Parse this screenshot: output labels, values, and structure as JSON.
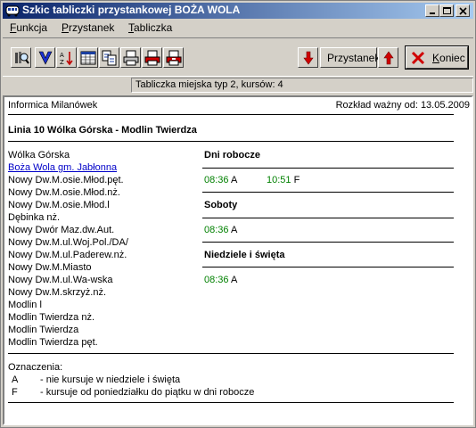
{
  "window": {
    "title": "Szkic tabliczki przystankowej BOŻA WOLA"
  },
  "menu": {
    "items": [
      {
        "first": "F",
        "rest": "unkcja"
      },
      {
        "first": "P",
        "rest": "rzystanek"
      },
      {
        "first": "T",
        "rest": "abliczka"
      }
    ]
  },
  "toolbar": {
    "stop_button_label": "Przystanek",
    "end_button_label": "Koniec",
    "end_button_first": "K",
    "end_button_rest": "oniec"
  },
  "status": {
    "text": "Tabliczka miejska typ 2, kursów: 4"
  },
  "doc": {
    "operator": "Informica Milanówek",
    "validity": "Rozkład ważny od: 13.05.2009",
    "line_title": "Linia 10 Wólka Górska - Modlin Twierdza",
    "stops": [
      "Wólka Górska",
      "Boża Wola gm. Jabłonna",
      "Nowy Dw.M.osie.Młod.pęt.",
      "Nowy Dw.M.osie.Młod.nż.",
      "Nowy Dw.M.osie.Młod.l",
      "Dębinka nż.",
      "Nowy Dwór Maz.dw.Aut.",
      "Nowy Dw.M.ul.Woj.Pol./DA/",
      "Nowy Dw.M.ul.Paderew.nż.",
      "Nowy Dw.M.Miasto",
      "Nowy Dw.M.ul.Wa-wska",
      "Nowy Dw.M.skrzyż.nż.",
      "Modlin l",
      "Modlin Twierdza nż.",
      "Modlin Twierdza",
      "Modlin Twierdza pęt."
    ],
    "sections": [
      {
        "title": "Dni robocze",
        "times": [
          {
            "time": "08:36",
            "flag": "A"
          },
          {
            "time": "10:51",
            "flag": "F"
          }
        ]
      },
      {
        "title": "Soboty",
        "times": [
          {
            "time": "08:36",
            "flag": "A"
          }
        ]
      },
      {
        "title": "Niedziele i święta",
        "times": [
          {
            "time": "08:36",
            "flag": "A"
          }
        ]
      }
    ],
    "legend_title": "Oznaczenia:",
    "legend": [
      {
        "code": "A",
        "text": "- nie kursuje w niedziele i święta"
      },
      {
        "code": "F",
        "text": "- kursuje od poniedziałku do piątku w dni robocze"
      }
    ]
  },
  "colors": {
    "title_gradient_start": "#0a246a",
    "title_gradient_end": "#a6caf0",
    "time_green": "#008000",
    "link_blue": "#0000c8",
    "arrow_red": "#d00000"
  }
}
